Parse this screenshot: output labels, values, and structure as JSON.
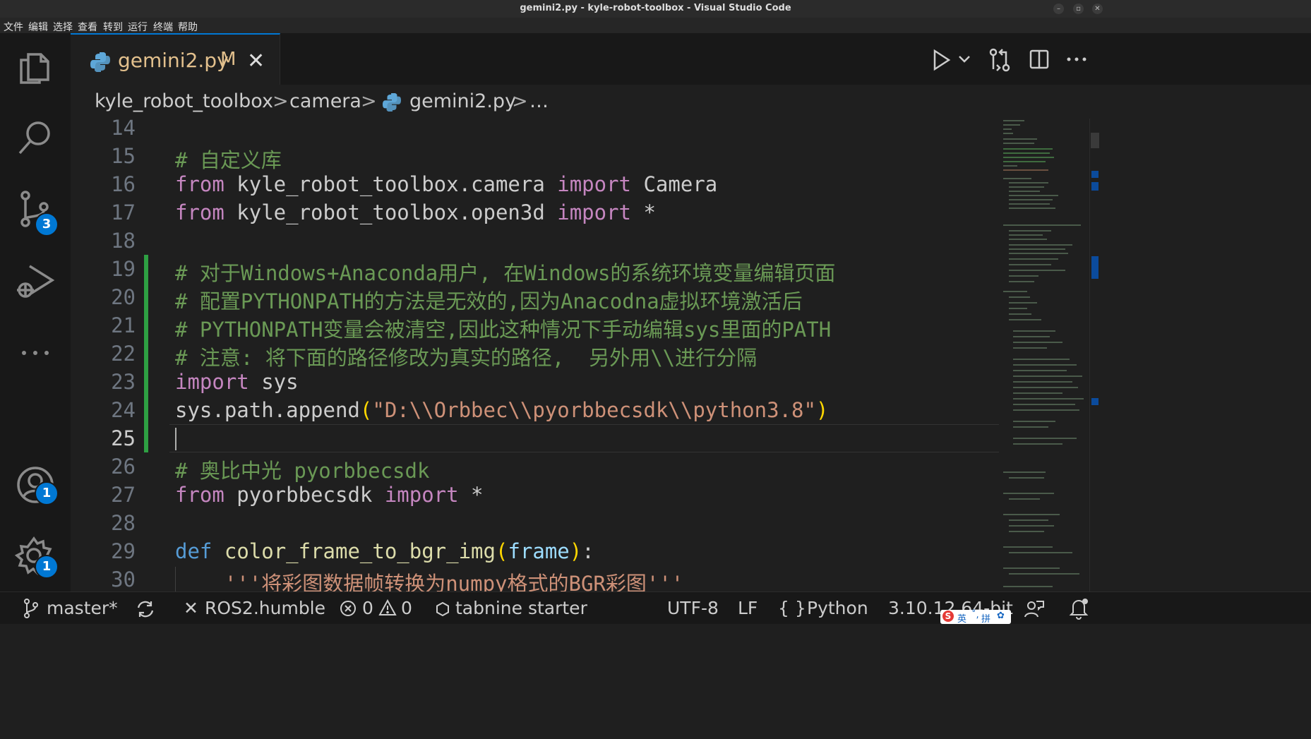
{
  "window": {
    "title": "gemini2.py - kyle-robot-toolbox - Visual Studio Code"
  },
  "menu": [
    "文件",
    "编辑",
    "选择",
    "查看",
    "转到",
    "运行",
    "终端",
    "帮助"
  ],
  "activity": {
    "icons": [
      "explorer-icon",
      "search-icon",
      "source-control-icon",
      "run-debug-icon",
      "more-icon",
      "accounts-icon",
      "settings-icon"
    ],
    "scm_badge": "3",
    "accounts_badge": "1",
    "settings_badge": "1"
  },
  "tab": {
    "filename": "gemini2.py",
    "modified": "M",
    "close": "✕"
  },
  "breadcrumb": {
    "root": "kyle_robot_toolbox",
    "folder": "camera",
    "file": "gemini2.py",
    "more": "…",
    "sep": ">"
  },
  "editor": {
    "active_line": "25",
    "line_numbers": [
      "14",
      "15",
      "16",
      "17",
      "18",
      "19",
      "20",
      "21",
      "22",
      "23",
      "24",
      "25",
      "26",
      "27",
      "28",
      "29",
      "30"
    ],
    "lines": {
      "l15": "# 自定义库",
      "l16_a": "from",
      "l16_b": " kyle_robot_toolbox.camera ",
      "l16_c": "import",
      "l16_d": " Camera",
      "l17_a": "from",
      "l17_b": " kyle_robot_toolbox.open3d ",
      "l17_c": "import",
      "l17_d": " *",
      "l19": "# 对于Windows+Anaconda用户, 在Windows的系统环境变量编辑页面",
      "l20": "# 配置PYTHONPATH的方法是无效的,因为Anacodna虚拟环境激活后",
      "l21": "# PYTHONPATH变量会被清空,因此这种情况下手动编辑sys里面的PATH",
      "l22": "# 注意: 将下面的路径修改为真实的路径,  另外用\\\\进行分隔",
      "l23_a": "import",
      "l23_b": " sys",
      "l24_a": "sys.path.append",
      "l24_b": "(",
      "l24_c": "\"D:\\\\Orbbec\\\\pyorbbecsdk\\\\python3.8\"",
      "l24_d": ")",
      "l26": "# 奥比中光 pyorbbecsdk",
      "l27_a": "from",
      "l27_b": " pyorbbecsdk ",
      "l27_c": "import",
      "l27_d": " *",
      "l29_a": "def",
      "l29_b": " ",
      "l29_c": "color_frame_to_bgr_img",
      "l29_d": "(",
      "l29_e": "frame",
      "l29_f": ")",
      "l29_g": ":",
      "l30": "    '''将彩图数据帧转换为numpy格式的BGR彩图'''"
    }
  },
  "status": {
    "branch": "master*",
    "remote": "ROS2.humble",
    "errors": "0",
    "warnings": "0",
    "tabnine": "tabnine starter",
    "encoding": "UTF-8",
    "eol": "LF",
    "language_braces": "{ }",
    "language": "Python",
    "interpreter": "3.10.12 64-bit"
  },
  "ime": {
    "label_en": "英",
    "label_pin": "拼"
  },
  "colors": {
    "accent": "#0078d4",
    "git_added": "#2ea043",
    "comment": "#6a9955",
    "keyword_control": "#c586c0",
    "string": "#ce9178"
  }
}
